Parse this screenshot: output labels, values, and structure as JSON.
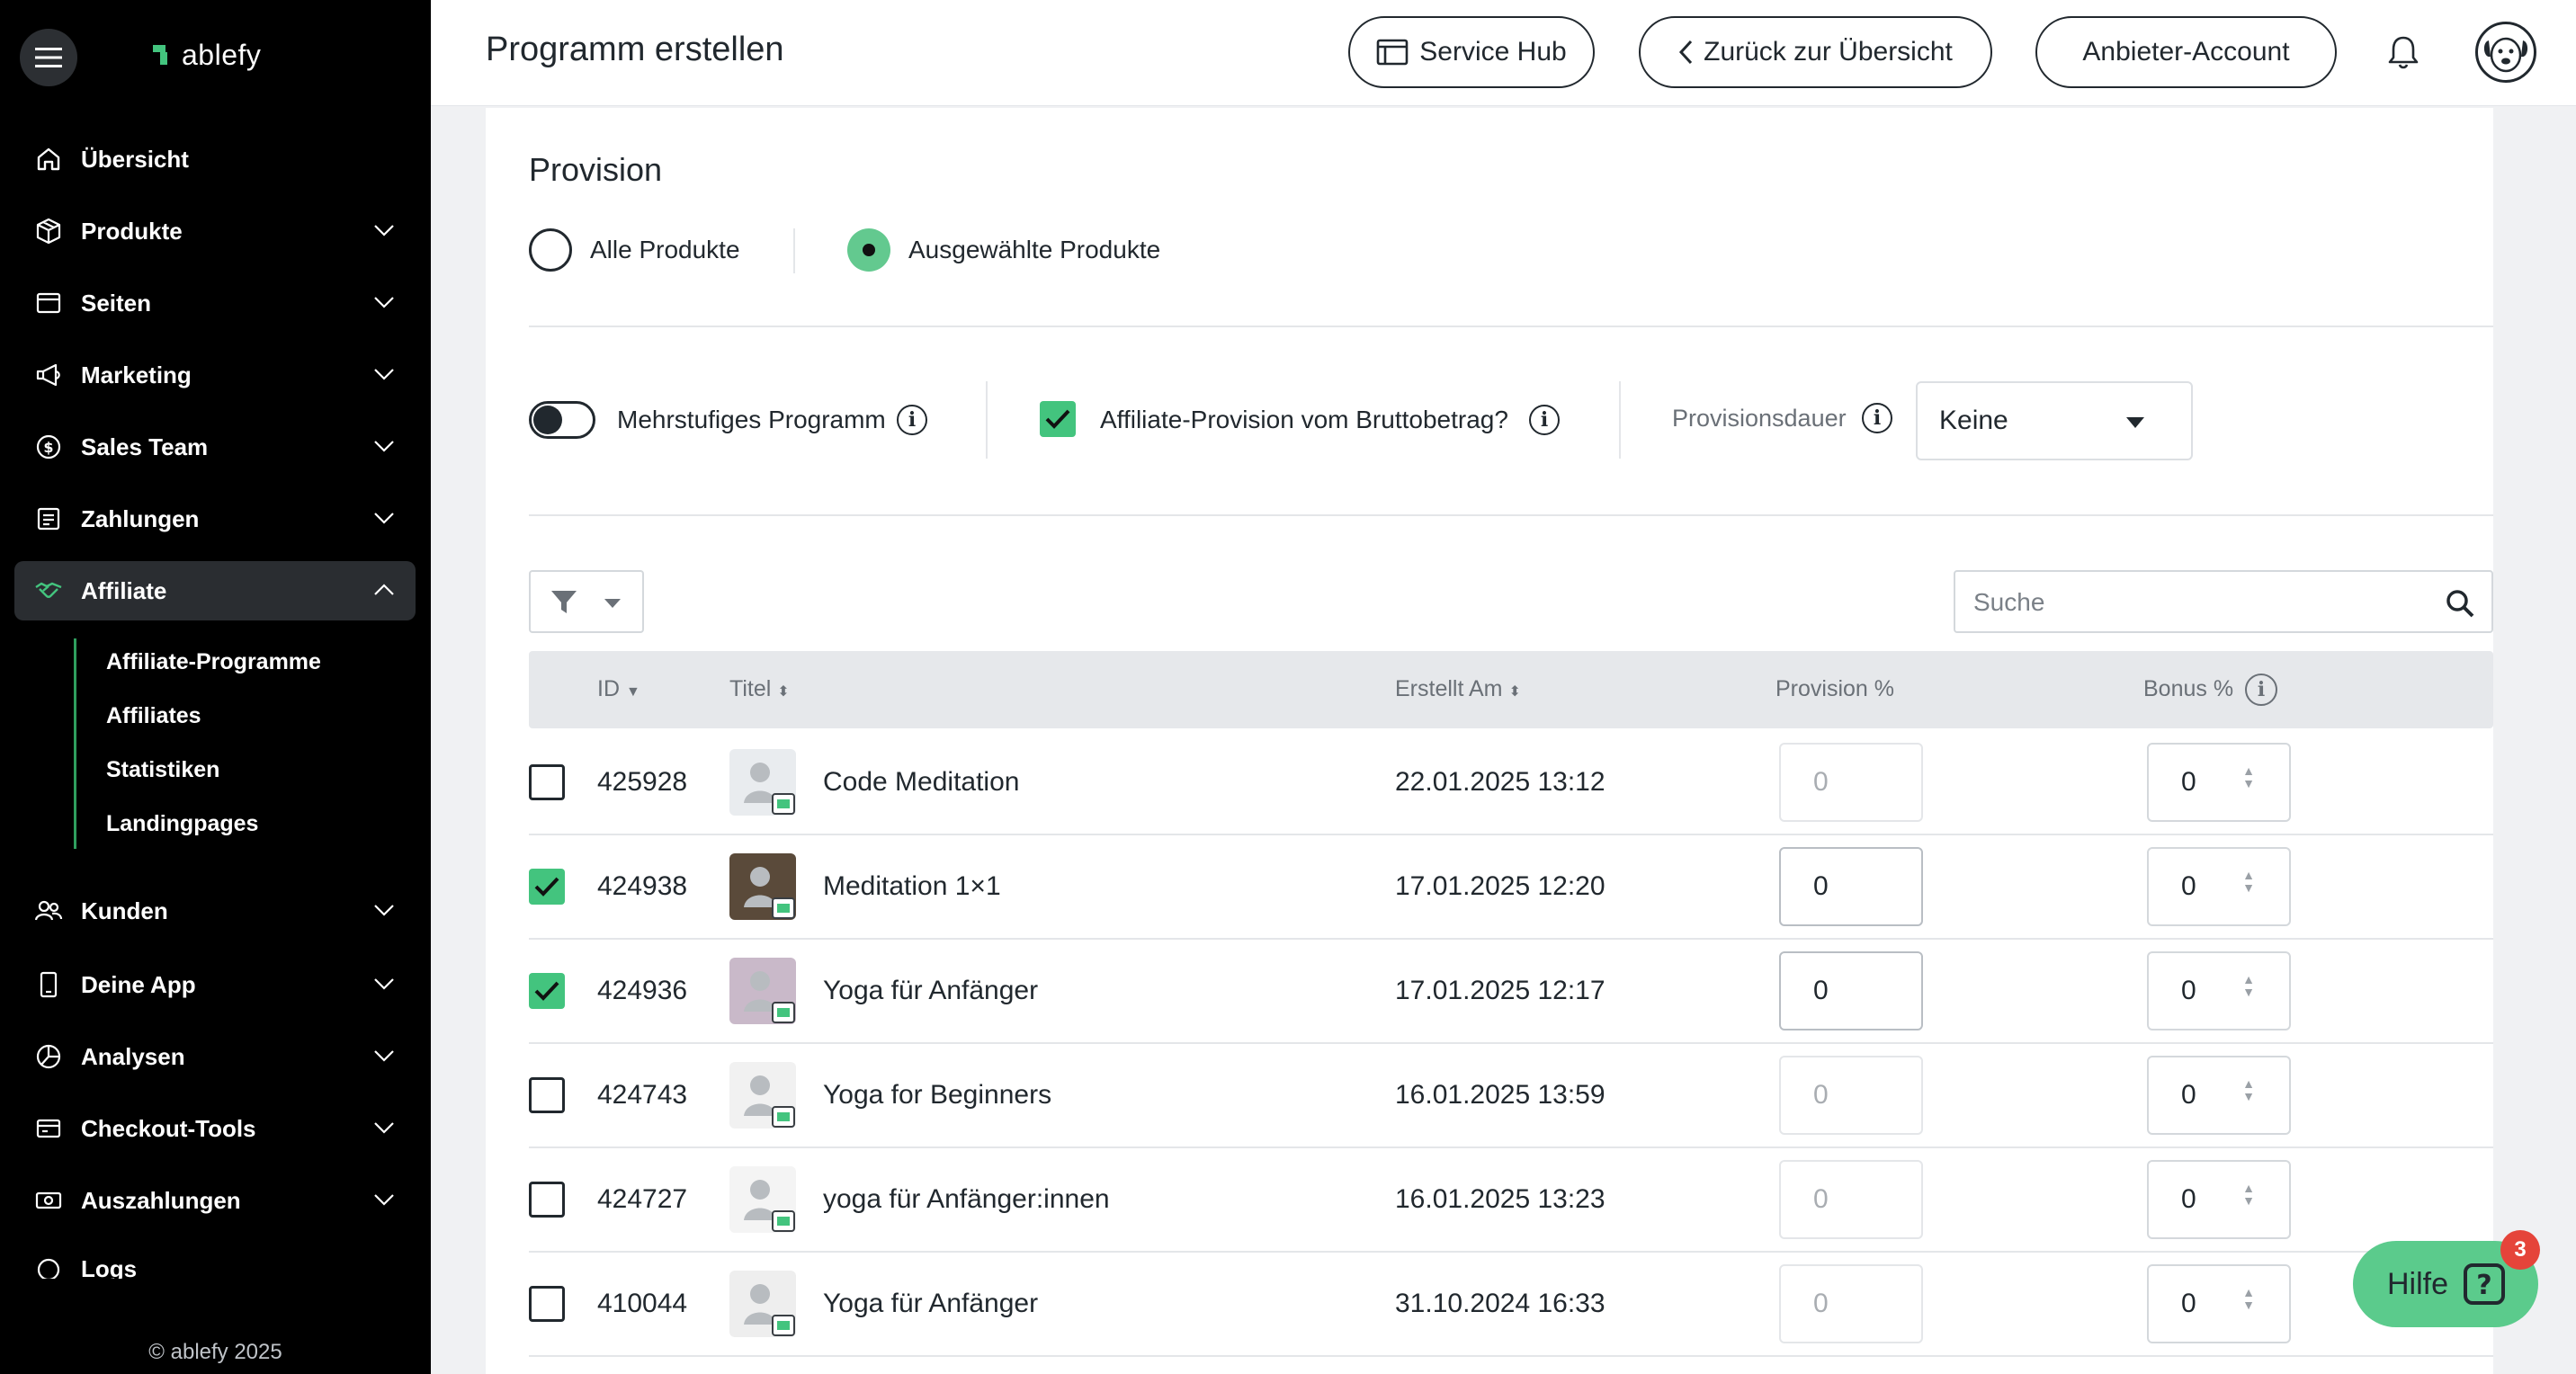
{
  "sidebar": {
    "brand": "ablefy",
    "items": [
      {
        "label": "Übersicht",
        "icon": "home-icon"
      },
      {
        "label": "Produkte",
        "icon": "box-icon"
      },
      {
        "label": "Seiten",
        "icon": "page-icon"
      },
      {
        "label": "Marketing",
        "icon": "megaphone-icon"
      },
      {
        "label": "Sales Team",
        "icon": "dollar-icon"
      },
      {
        "label": "Zahlungen",
        "icon": "receipt-icon"
      },
      {
        "label": "Affiliate",
        "icon": "handshake-icon"
      },
      {
        "label": "Kunden",
        "icon": "users-icon"
      },
      {
        "label": "Deine App",
        "icon": "phone-icon"
      },
      {
        "label": "Analysen",
        "icon": "pie-icon"
      },
      {
        "label": "Checkout-Tools",
        "icon": "checkout-icon"
      },
      {
        "label": "Auszahlungen",
        "icon": "cash-icon"
      },
      {
        "label": "Logs",
        "icon": "logs-icon"
      }
    ],
    "sub_items": [
      "Affiliate-Programme",
      "Affiliates",
      "Statistiken",
      "Landingpages"
    ],
    "copyright": "© ablefy 2025"
  },
  "header": {
    "title": "Programm erstellen",
    "service_hub": "Service Hub",
    "back": "Zurück zur Übersicht",
    "account": "Anbieter-Account"
  },
  "provision": {
    "title": "Provision",
    "radio_all": "Alle Produkte",
    "radio_selected": "Ausgewählte Produkte",
    "multi_level": "Mehrstufiges Programm",
    "gross": "Affiliate-Provision vom Bruttobetrag?",
    "duration_label": "Provisionsdauer",
    "duration_value": "Keine",
    "search_placeholder": "Suche"
  },
  "table": {
    "headers": {
      "id": "ID",
      "title": "Titel",
      "created": "Erstellt Am",
      "provision": "Provision %",
      "bonus": "Bonus %"
    },
    "rows": [
      {
        "checked": false,
        "id": "425928",
        "title": "Code Meditation",
        "created": "22.01.2025 13:12",
        "provision": "0",
        "bonus": "0"
      },
      {
        "checked": true,
        "id": "424938",
        "title": "Meditation 1×1",
        "created": "17.01.2025 12:20",
        "provision": "0",
        "bonus": "0"
      },
      {
        "checked": true,
        "id": "424936",
        "title": "Yoga für Anfänger",
        "created": "17.01.2025 12:17",
        "provision": "0",
        "bonus": "0"
      },
      {
        "checked": false,
        "id": "424743",
        "title": "Yoga for Beginners",
        "created": "16.01.2025 13:59",
        "provision": "0",
        "bonus": "0"
      },
      {
        "checked": false,
        "id": "424727",
        "title": "yoga für Anfänger:innen",
        "created": "16.01.2025 13:23",
        "provision": "0",
        "bonus": "0"
      },
      {
        "checked": false,
        "id": "410044",
        "title": "Yoga für Anfänger",
        "created": "31.10.2024 16:33",
        "provision": "0",
        "bonus": "0"
      }
    ]
  },
  "help": {
    "label": "Hilfe",
    "badge": "3"
  },
  "colors": {
    "accent": "#5bcb8c",
    "sidebar": "#000000",
    "badge": "#e5443a"
  }
}
